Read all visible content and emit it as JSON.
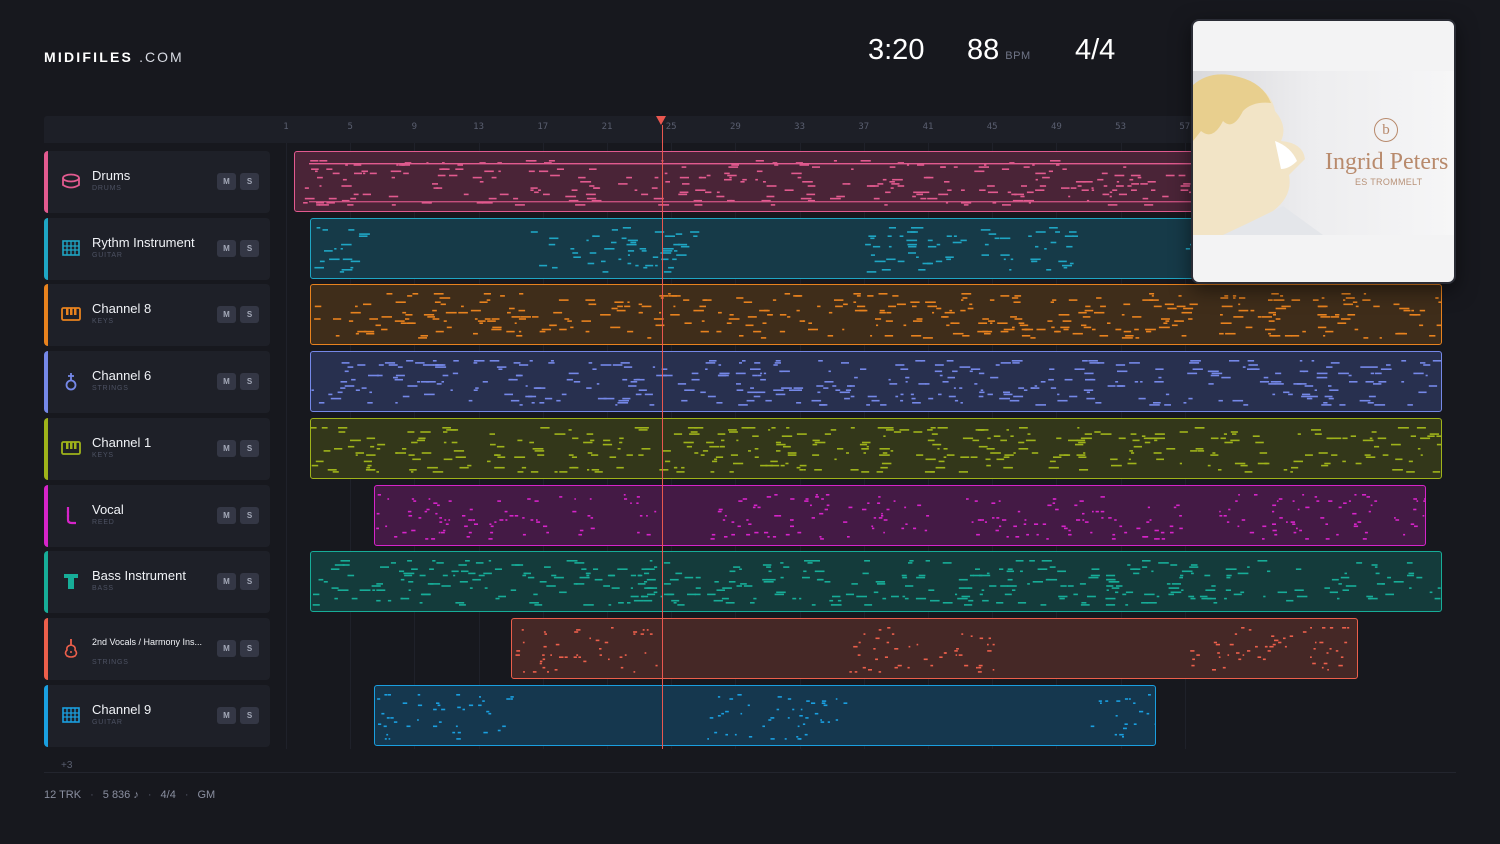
{
  "brand": {
    "name": "MIDIFILES",
    "suffix": ".COM"
  },
  "header": {
    "duration": "3:20",
    "bpm": "88",
    "bpm_label": "BPM",
    "time_signature": "4/4"
  },
  "ruler": {
    "ticks": [
      "1",
      "5",
      "9",
      "13",
      "17",
      "21",
      "25",
      "29",
      "33",
      "37",
      "41",
      "45",
      "49",
      "53",
      "57"
    ]
  },
  "playhead": {
    "bar": 24.4
  },
  "tracks": [
    {
      "name": "Drums",
      "type": "DRUMS",
      "icon": "drum-icon",
      "color": "#e25a8f",
      "fill": "#4a2437",
      "start": 0,
      "end": 1
    },
    {
      "name": "Rythm Instrument",
      "type": "GUITAR",
      "icon": "guitar-grid-icon",
      "color": "#1fa6c4",
      "fill": "#163a48",
      "start": 0,
      "end": 1
    },
    {
      "name": "Channel 8",
      "type": "KEYS",
      "icon": "keyboard-icon",
      "color": "#e8821e",
      "fill": "#3f2d1a",
      "start": 0,
      "end": 1
    },
    {
      "name": "Channel 6",
      "type": "STRINGS",
      "icon": "strings-icon",
      "color": "#7588e8",
      "fill": "#28304f",
      "start": 0,
      "end": 1
    },
    {
      "name": "Channel 1",
      "type": "KEYS",
      "icon": "keyboard-icon",
      "color": "#9fb31a",
      "fill": "#33371a",
      "start": 0,
      "end": 1
    },
    {
      "name": "Vocal",
      "type": "REED",
      "icon": "reed-icon",
      "color": "#d624c9",
      "fill": "#441a45",
      "start": 0,
      "end": 1
    },
    {
      "name": "Bass Instrument",
      "type": "BASS",
      "icon": "bass-icon",
      "color": "#17ad98",
      "fill": "#143b3b",
      "start": 0,
      "end": 1
    },
    {
      "name": "2nd Vocals / Harmony Ins...",
      "type": "STRINGS",
      "icon": "violin-icon",
      "color": "#ec5f4b",
      "fill": "#452826",
      "start": 0,
      "end": 1
    },
    {
      "name": "Channel 9",
      "type": "GUITAR",
      "icon": "guitar-grid-icon",
      "color": "#1a9fe0",
      "fill": "#15374e",
      "start": 0,
      "end": 1
    }
  ],
  "mute_label": "M",
  "solo_label": "S",
  "more_tracks": "+3",
  "footer": {
    "tracks": "12 TRK",
    "notes": "5 836 ♪",
    "time_signature": "4/4",
    "standard": "GM"
  },
  "cover": {
    "artist": "Ingrid Peters",
    "album": "ES TROMMELT",
    "monogram": "b"
  }
}
